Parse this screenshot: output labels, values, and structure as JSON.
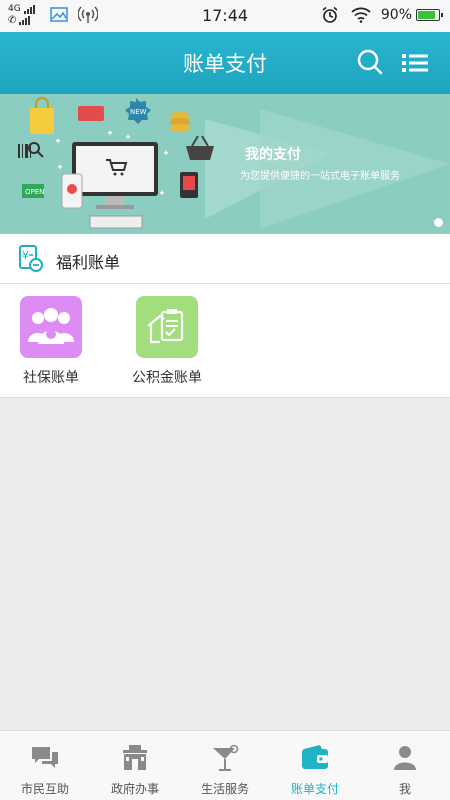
{
  "status_bar": {
    "network": "4G",
    "time": "17:44",
    "battery": "90%"
  },
  "header": {
    "title": "账单支付",
    "search_icon": "search-icon",
    "menu_icon": "list-menu-icon"
  },
  "banner": {
    "title": "我的支付",
    "subtitle": "为您提供便捷的一站式电子账单服务",
    "badge": "NEW",
    "sign": "OPEN"
  },
  "section": {
    "title": "福利账单",
    "icon": "bill-icon",
    "items": [
      {
        "label": "社保账单",
        "icon": "people-icon",
        "color": "#dc8cf2"
      },
      {
        "label": "公积金账单",
        "icon": "house-clipboard-icon",
        "color": "#a2dd7e"
      }
    ]
  },
  "bottom_nav": {
    "items": [
      {
        "label": "市民互助",
        "icon": "chat-bubbles-icon"
      },
      {
        "label": "政府办事",
        "icon": "government-building-icon"
      },
      {
        "label": "生活服务",
        "icon": "cocktail-icon"
      },
      {
        "label": "账单支付",
        "icon": "wallet-icon",
        "active": true
      },
      {
        "label": "我",
        "icon": "person-icon"
      }
    ],
    "active_color": "#20b3c4"
  }
}
